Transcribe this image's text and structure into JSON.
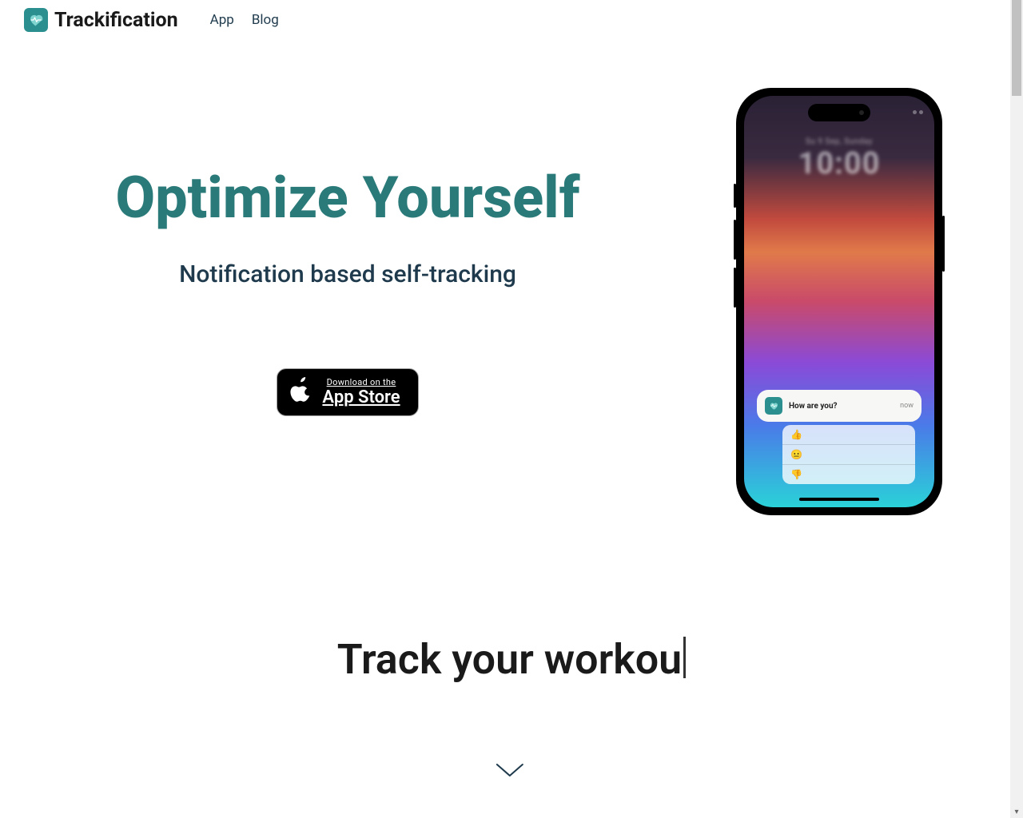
{
  "brand": {
    "name": "Trackification"
  },
  "nav": {
    "app": "App",
    "blog": "Blog"
  },
  "hero": {
    "title": "Optimize Yourself",
    "subtitle": "Notification based self-tracking"
  },
  "appstore": {
    "small": "Download on the",
    "big": "App Store"
  },
  "phone": {
    "date": "Su 9 Sep, Sunday",
    "clock": "10:00",
    "notif_text": "How are you?",
    "notif_time": "now",
    "options": [
      "👍",
      "😐",
      "👎"
    ]
  },
  "track": {
    "prefix": "Track your ",
    "typed": "workou"
  }
}
